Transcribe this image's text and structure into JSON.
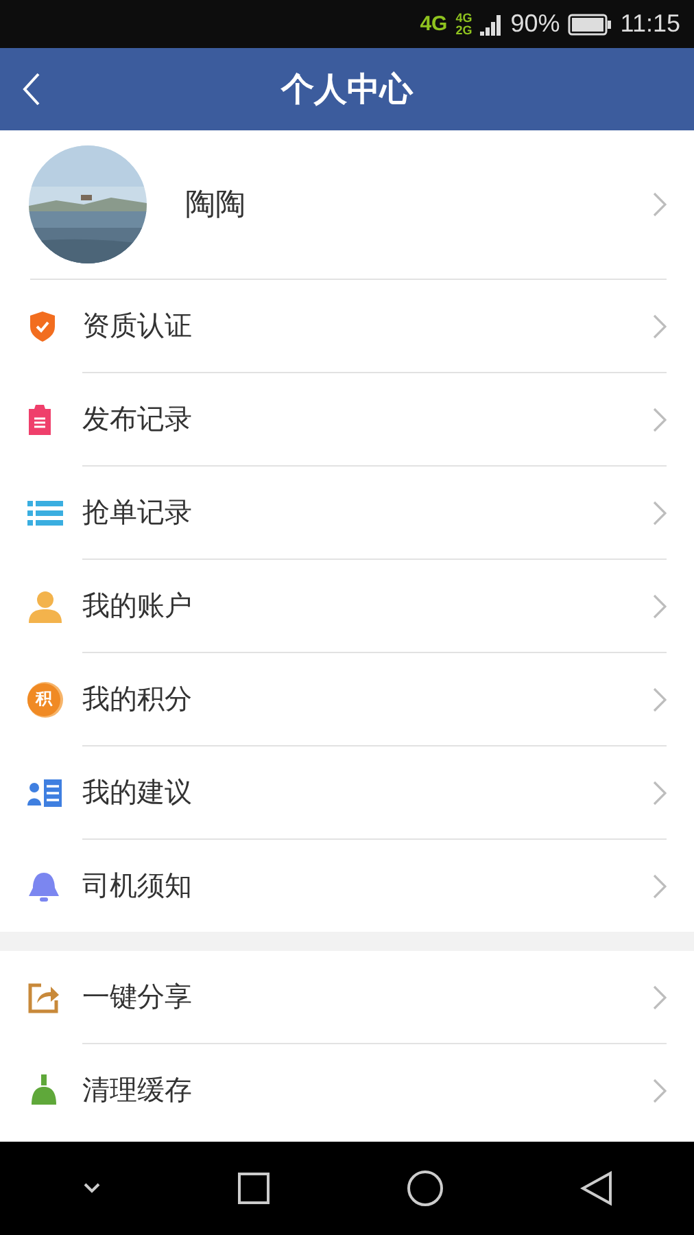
{
  "status_bar": {
    "network": "4G",
    "sim_upper": "4G",
    "sim_lower": "2G",
    "battery": "90%",
    "time": "11:15"
  },
  "header": {
    "title": "个人中心"
  },
  "profile": {
    "name": "陶陶"
  },
  "menu": [
    {
      "label": "资质认证",
      "kind": "shield"
    },
    {
      "label": "发布记录",
      "kind": "clipboard"
    },
    {
      "label": "抢单记录",
      "kind": "list"
    },
    {
      "label": "我的账户",
      "kind": "person"
    },
    {
      "label": "我的积分",
      "kind": "points",
      "icon_text": "积"
    },
    {
      "label": "我的建议",
      "kind": "feedback"
    },
    {
      "label": "司机须知",
      "kind": "bell"
    }
  ],
  "menu_2": [
    {
      "label": "一键分享",
      "kind": "share"
    },
    {
      "label": "清理缓存",
      "kind": "broom"
    }
  ]
}
